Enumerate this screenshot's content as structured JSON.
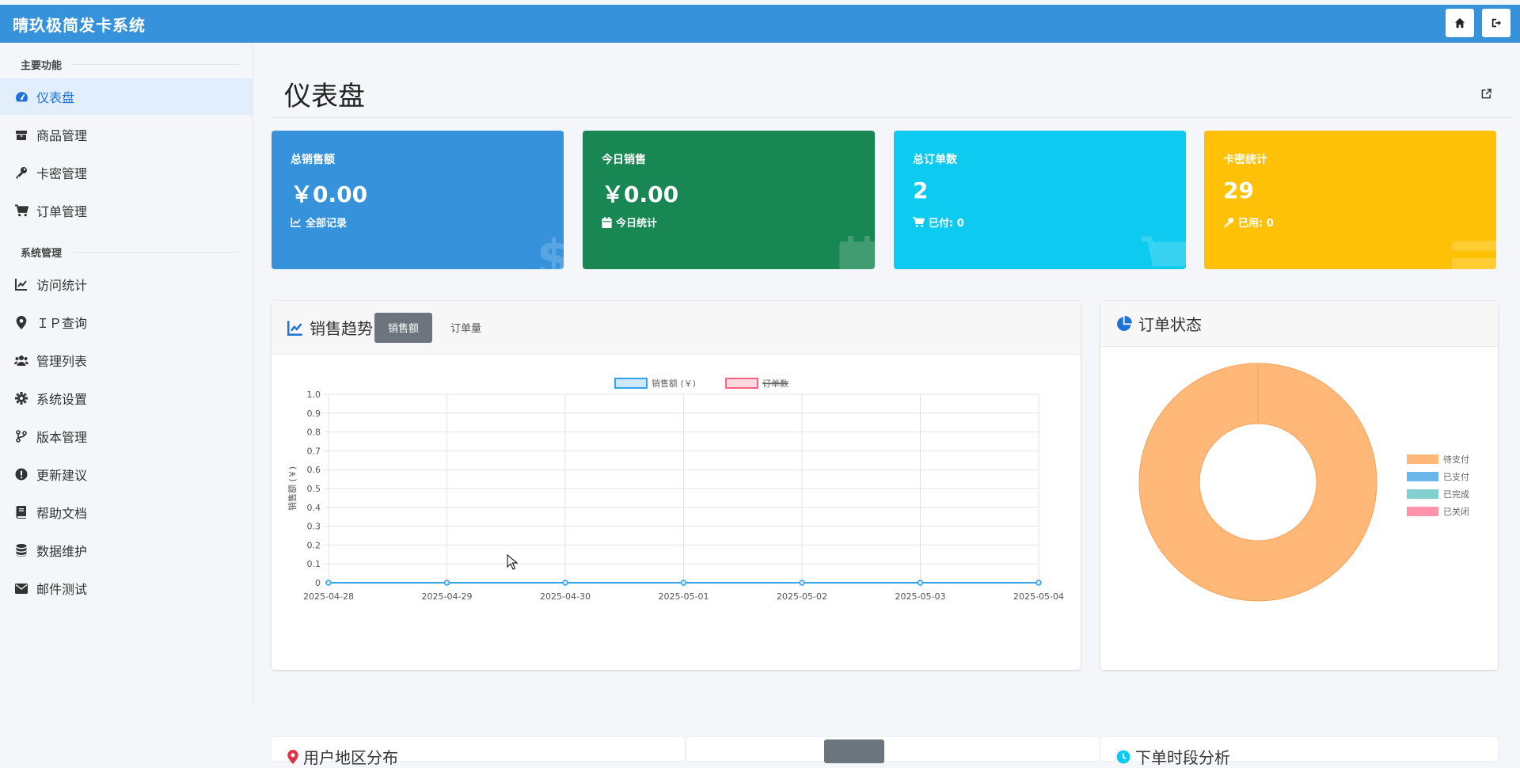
{
  "app": {
    "title": "晴玖极简发卡系统"
  },
  "sidebar": {
    "section_main": "主要功能",
    "section_system": "系统管理",
    "main_items": [
      {
        "label": "仪表盘",
        "icon": "gauge-icon",
        "active": true
      },
      {
        "label": "商品管理",
        "icon": "box-icon"
      },
      {
        "label": "卡密管理",
        "icon": "key-icon"
      },
      {
        "label": "订单管理",
        "icon": "cart-icon"
      }
    ],
    "system_items": [
      {
        "label": "访问统计",
        "icon": "chart-line-icon"
      },
      {
        "label": "ＩＰ查询",
        "icon": "map-pin-icon"
      },
      {
        "label": "管理列表",
        "icon": "users-icon"
      },
      {
        "label": "系统设置",
        "icon": "gear-icon"
      },
      {
        "label": "版本管理",
        "icon": "branch-icon"
      },
      {
        "label": "更新建议",
        "icon": "exclamation-icon"
      },
      {
        "label": "帮助文档",
        "icon": "book-icon"
      },
      {
        "label": "数据维护",
        "icon": "database-icon"
      },
      {
        "label": "邮件测试",
        "icon": "envelope-icon"
      }
    ]
  },
  "page": {
    "title": "仪表盘"
  },
  "stats": [
    {
      "label": "总销售额",
      "value": "￥0.00",
      "sub": "全部记录",
      "color": "#3592db"
    },
    {
      "label": "今日销售",
      "value": "￥0.00",
      "sub": "今日统计",
      "color": "#198754"
    },
    {
      "label": "总订单数",
      "value": "2",
      "sub": "已付: 0",
      "color": "#0dcaf0"
    },
    {
      "label": "卡密统计",
      "value": "29",
      "sub": "已用: 0",
      "color": "#ffc107"
    }
  ],
  "sales_card": {
    "title": "销售趋势",
    "tab_active": "销售额",
    "tab_other": "订单量"
  },
  "status_card": {
    "title": "订单状态"
  },
  "bottom_cards": {
    "region_title": "用户地区分布",
    "time_title": "下单时段分析"
  },
  "chart_data": [
    {
      "type": "line",
      "x": [
        "2025-04-28",
        "2025-04-29",
        "2025-04-30",
        "2025-05-01",
        "2025-05-02",
        "2025-05-03",
        "2025-05-04"
      ],
      "series": [
        {
          "name": "销售额 (￥)",
          "values": [
            0,
            0,
            0,
            0,
            0,
            0,
            0
          ],
          "color": "#36a2eb",
          "hidden": false
        },
        {
          "name": "订单数",
          "values": [
            0,
            0,
            0,
            0,
            0,
            0,
            0
          ],
          "color": "#ff6384",
          "hidden": true
        }
      ],
      "ylabel": "销售额 (￥)",
      "ylim": [
        0,
        1
      ],
      "yticks": [
        "0",
        "0.1",
        "0.2",
        "0.3",
        "0.4",
        "0.5",
        "0.6",
        "0.7",
        "0.8",
        "0.9",
        "1.0"
      ],
      "grid": true,
      "legend": "top"
    },
    {
      "type": "pie",
      "variant": "doughnut",
      "categories": [
        "待支付",
        "已支付",
        "已完成",
        "已关闭"
      ],
      "values": [
        1,
        0,
        0,
        0
      ],
      "colors": [
        "#ffb878",
        "#6bb7ec",
        "#7fd0ce",
        "#ff93a9"
      ],
      "legend": "right"
    }
  ]
}
